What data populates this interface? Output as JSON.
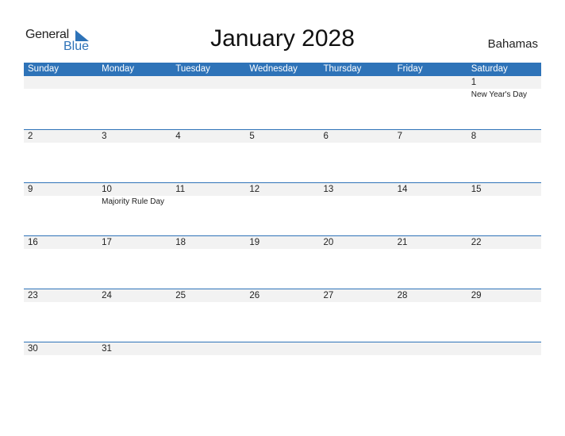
{
  "logo": {
    "text_general": "General",
    "text_blue": "Blue",
    "icon": "triangle-flag-icon"
  },
  "header": {
    "title": "January 2028",
    "country": "Bahamas"
  },
  "colors": {
    "accent": "#2e73b8",
    "strip": "#f2f2f2"
  },
  "weekdays": [
    "Sunday",
    "Monday",
    "Tuesday",
    "Wednesday",
    "Thursday",
    "Friday",
    "Saturday"
  ],
  "weeks": [
    [
      {
        "date": "",
        "event": ""
      },
      {
        "date": "",
        "event": ""
      },
      {
        "date": "",
        "event": ""
      },
      {
        "date": "",
        "event": ""
      },
      {
        "date": "",
        "event": ""
      },
      {
        "date": "",
        "event": ""
      },
      {
        "date": "1",
        "event": "New Year's Day"
      }
    ],
    [
      {
        "date": "2",
        "event": ""
      },
      {
        "date": "3",
        "event": ""
      },
      {
        "date": "4",
        "event": ""
      },
      {
        "date": "5",
        "event": ""
      },
      {
        "date": "6",
        "event": ""
      },
      {
        "date": "7",
        "event": ""
      },
      {
        "date": "8",
        "event": ""
      }
    ],
    [
      {
        "date": "9",
        "event": ""
      },
      {
        "date": "10",
        "event": "Majority Rule Day"
      },
      {
        "date": "11",
        "event": ""
      },
      {
        "date": "12",
        "event": ""
      },
      {
        "date": "13",
        "event": ""
      },
      {
        "date": "14",
        "event": ""
      },
      {
        "date": "15",
        "event": ""
      }
    ],
    [
      {
        "date": "16",
        "event": ""
      },
      {
        "date": "17",
        "event": ""
      },
      {
        "date": "18",
        "event": ""
      },
      {
        "date": "19",
        "event": ""
      },
      {
        "date": "20",
        "event": ""
      },
      {
        "date": "21",
        "event": ""
      },
      {
        "date": "22",
        "event": ""
      }
    ],
    [
      {
        "date": "23",
        "event": ""
      },
      {
        "date": "24",
        "event": ""
      },
      {
        "date": "25",
        "event": ""
      },
      {
        "date": "26",
        "event": ""
      },
      {
        "date": "27",
        "event": ""
      },
      {
        "date": "28",
        "event": ""
      },
      {
        "date": "29",
        "event": ""
      }
    ],
    [
      {
        "date": "30",
        "event": ""
      },
      {
        "date": "31",
        "event": ""
      },
      {
        "date": "",
        "event": ""
      },
      {
        "date": "",
        "event": ""
      },
      {
        "date": "",
        "event": ""
      },
      {
        "date": "",
        "event": ""
      },
      {
        "date": "",
        "event": ""
      }
    ]
  ]
}
